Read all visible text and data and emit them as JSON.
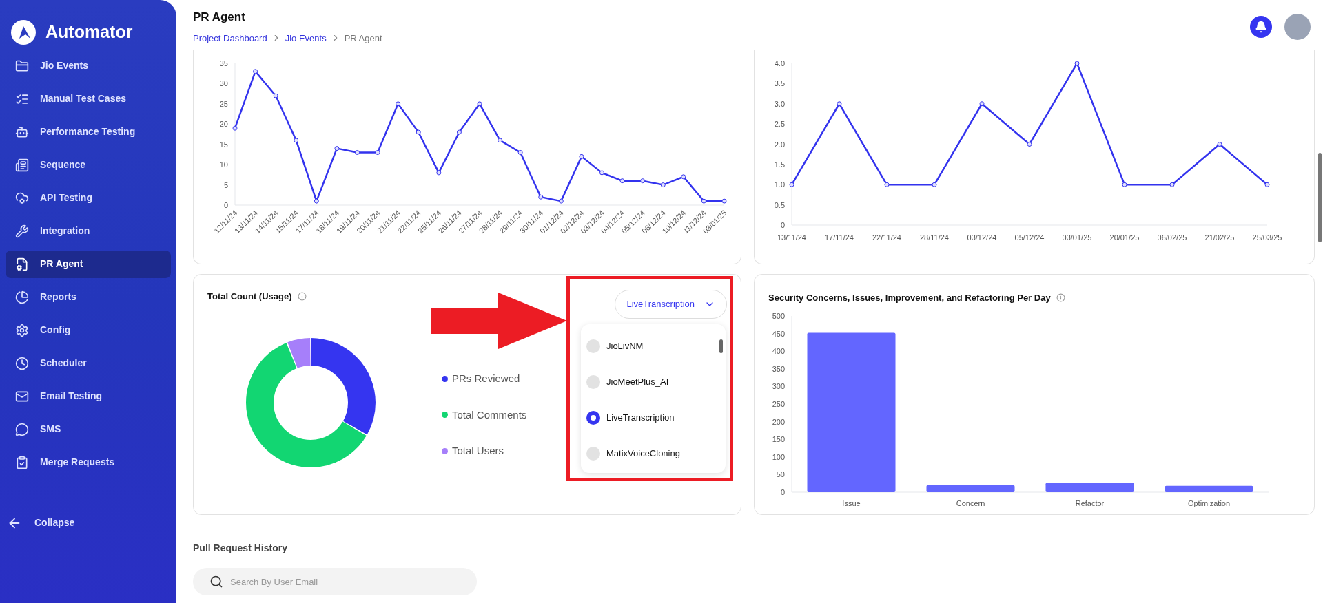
{
  "sidebar": {
    "brand": "Automator",
    "items": [
      {
        "label": "Jio Events",
        "selected": false
      },
      {
        "label": "Manual Test Cases",
        "selected": false
      },
      {
        "label": "Performance Testing",
        "selected": false
      },
      {
        "label": "Sequence",
        "selected": false
      },
      {
        "label": "API Testing",
        "selected": false
      },
      {
        "label": "Integration",
        "selected": false
      },
      {
        "label": "PR Agent",
        "selected": true
      },
      {
        "label": "Reports",
        "selected": false
      },
      {
        "label": "Config",
        "selected": false
      },
      {
        "label": "Scheduler",
        "selected": false
      },
      {
        "label": "Email Testing",
        "selected": false
      },
      {
        "label": "SMS",
        "selected": false
      },
      {
        "label": "Merge Requests",
        "selected": false
      }
    ],
    "collapse": "Collapse"
  },
  "header": {
    "title": "PR Agent",
    "breadcrumb": [
      "Project Dashboard",
      "Jio Events",
      "PR Agent"
    ]
  },
  "charts": [
    {
      "chart_data": {
        "type": "line",
        "categories": [
          "12/11/24",
          "13/11/24",
          "14/11/24",
          "15/11/24",
          "17/11/24",
          "18/11/24",
          "19/11/24",
          "20/11/24",
          "21/11/24",
          "22/11/24",
          "25/11/24",
          "26/11/24",
          "27/11/24",
          "28/11/24",
          "29/11/24",
          "30/11/24",
          "01/12/24",
          "02/12/24",
          "03/12/24",
          "04/12/24",
          "05/12/24",
          "06/12/24",
          "10/12/24",
          "11/12/24",
          "03/01/25"
        ],
        "series": [
          {
            "color": "#3333ee",
            "marker": true,
            "values": [
              19,
              33,
              27,
              16,
              1,
              14,
              13,
              13,
              25,
              18,
              8,
              18,
              25,
              16,
              13,
              2,
              1,
              12,
              8,
              6,
              6,
              5,
              7,
              1,
              1
            ]
          }
        ],
        "ylim": [
          0,
          35
        ],
        "yticks": [
          0,
          5,
          10,
          15,
          20,
          25,
          30,
          35
        ]
      }
    },
    {
      "chart_data": {
        "type": "line",
        "categories": [
          "13/11/24",
          "17/11/24",
          "22/11/24",
          "28/11/24",
          "03/12/24",
          "05/12/24",
          "03/01/25",
          "20/01/25",
          "06/02/25",
          "21/02/25",
          "25/03/25"
        ],
        "series": [
          {
            "color": "#3333ee",
            "marker": true,
            "values": [
              1,
              3,
              1,
              1,
              3,
              2,
              4,
              1,
              1,
              2,
              1
            ]
          }
        ],
        "ylim": [
          0,
          4
        ],
        "yticks": [
          {
            "value": 0,
            "label": "0"
          },
          {
            "value": 0.5,
            "label": "0.5"
          },
          {
            "value": 1,
            "label": "1.0"
          },
          {
            "value": 1.5,
            "label": "1.5"
          },
          {
            "value": 2,
            "label": "2.0"
          },
          {
            "value": 2.5,
            "label": "2.5"
          },
          {
            "value": 3,
            "label": "3.0"
          },
          {
            "value": 3.5,
            "label": "3.5"
          },
          {
            "value": 4,
            "label": "4.0"
          }
        ]
      }
    }
  ],
  "usage": {
    "title": "Total Count (Usage)",
    "legend": [
      {
        "label": "PRs Reviewed",
        "color": "#3535f0"
      },
      {
        "label": "Total Comments",
        "color": "#12d672"
      },
      {
        "label": "Total Users",
        "color": "#a67ffa"
      }
    ],
    "dropdown": {
      "value": "LiveTranscription",
      "expanded": true,
      "options": [
        {
          "label": "JioLivNM",
          "selected": false
        },
        {
          "label": "JioMeetPlus_AI",
          "selected": false
        },
        {
          "label": "LiveTranscription",
          "selected": true
        },
        {
          "label": "MatixVoiceCloning",
          "selected": false
        }
      ]
    }
  },
  "security": {
    "title": "Security Concerns, Issues, Improvement, and Refactoring Per Day",
    "chart_data": {
      "type": "bar",
      "categories": [
        "Issue",
        "Concern",
        "Refactor",
        "Optimization"
      ],
      "series": [
        {
          "color": "#6366ff",
          "values": [
            452,
            20,
            27,
            18
          ]
        }
      ],
      "ylim": [
        0,
        500
      ],
      "yticks": [
        0,
        50,
        100,
        150,
        200,
        250,
        300,
        350,
        400,
        450,
        500
      ]
    }
  },
  "history": {
    "title": "Pull Request History",
    "search": {
      "placeholder": "Search By User Email"
    }
  }
}
